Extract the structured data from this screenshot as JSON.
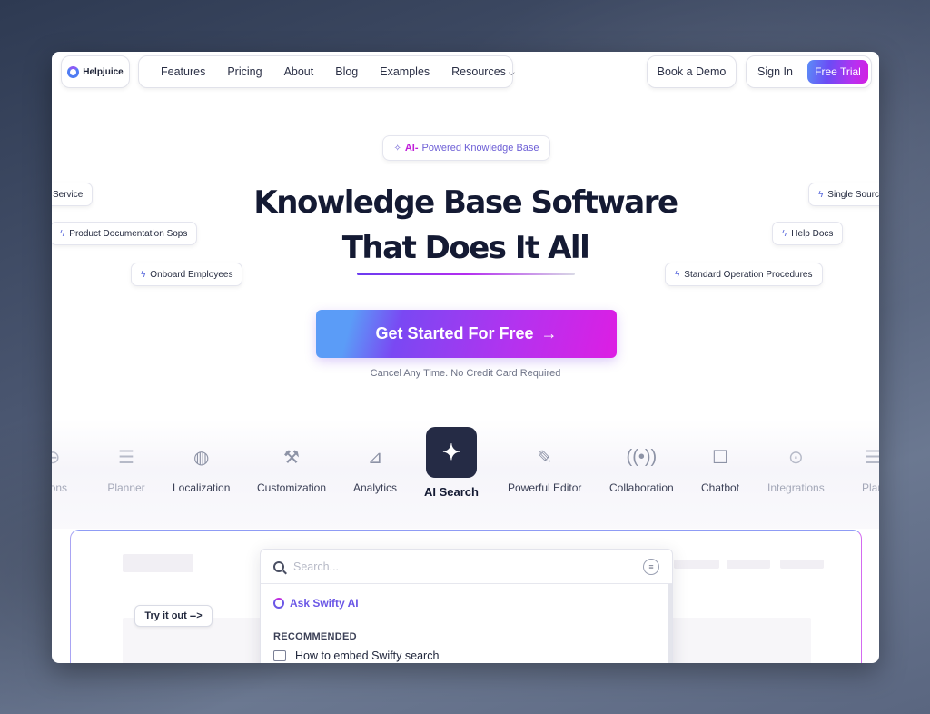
{
  "header": {
    "logo_text": "Helpjuice",
    "nav": [
      "Features",
      "Pricing",
      "About",
      "Blog",
      "Examples",
      "Resources"
    ],
    "book_demo": "Book a Demo",
    "sign_in": "Sign In",
    "free_trial": "Free Trial"
  },
  "hero": {
    "badge_ai": "AI-",
    "badge_rest": "Powered Knowledge Base",
    "title_line1": "Knowledge Base Software",
    "title_line2": "That Does It All",
    "cta": "Get Started For Free",
    "cta_arrow": "→",
    "note": "Cancel Any Time. No Credit Card Required"
  },
  "floating_tags": {
    "service": "Service",
    "product_docs": "Product Documentation Sops",
    "onboard": "Onboard Employees",
    "single_source": "Single Source",
    "help_docs": "Help Docs",
    "sop": "Standard Operation Procedures"
  },
  "features": [
    {
      "label": "ations",
      "icon": "integrations-icon"
    },
    {
      "label": "Planner",
      "icon": "planner-icon"
    },
    {
      "label": "Localization",
      "icon": "globe-icon"
    },
    {
      "label": "Customization",
      "icon": "wrench-icon"
    },
    {
      "label": "Analytics",
      "icon": "chart-icon"
    },
    {
      "label": "AI Search",
      "icon": "sparkles-icon"
    },
    {
      "label": "Powerful Editor",
      "icon": "pencil-icon"
    },
    {
      "label": "Collaboration",
      "icon": "broadcast-icon"
    },
    {
      "label": "Chatbot",
      "icon": "chat-icon"
    },
    {
      "label": "Integrations",
      "icon": "toggle-icon"
    },
    {
      "label": "Plan",
      "icon": "planner-icon"
    }
  ],
  "demo": {
    "try_it": "Try it out -->",
    "search_placeholder": "Search...",
    "ask": "Ask Swifty AI",
    "recommended": "RECOMMENDED",
    "rec_item": "How to embed Swifty search"
  },
  "colors": {
    "accent_purple": "#6b57e6",
    "accent_magenta": "#d41ee0",
    "accent_blue": "#5b9cf7",
    "dark": "#141a33"
  }
}
